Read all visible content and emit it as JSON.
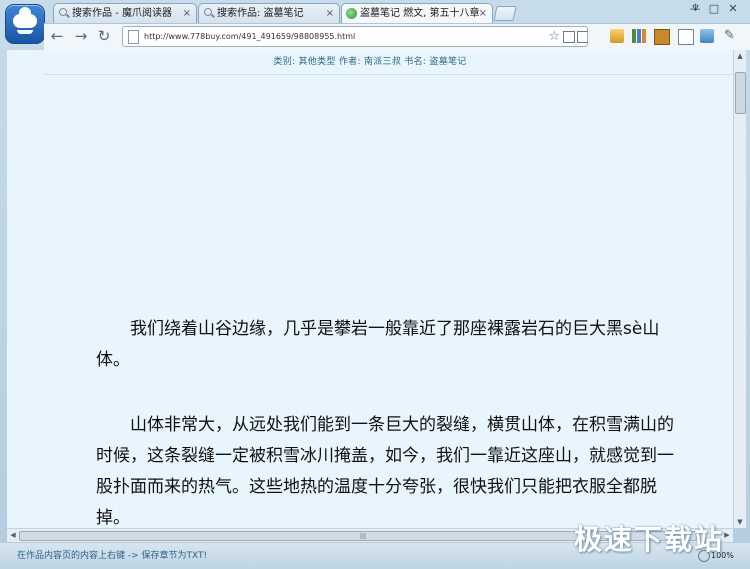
{
  "tabs": [
    {
      "label": "搜索作品 - 魔爪阅读器",
      "icon": "search-icon",
      "active": false
    },
    {
      "label": "搜索作品: 盗墓笔记",
      "icon": "search-icon",
      "active": false
    },
    {
      "label": "盗墓笔记 燃文, 第五十八章",
      "icon": "globe-icon",
      "active": true
    }
  ],
  "tab_close_glyph": "×",
  "toolbar": {
    "back": "←",
    "forward": "→",
    "reload": "↻",
    "url": "http://www.778buy.com/491_491659/98808955.html",
    "star": "☆"
  },
  "window": {
    "minimize": "—",
    "maximize": "□",
    "close": "✕"
  },
  "page": {
    "meta": "类别: 其他类型  作者: 南派三叔  书名: 盗墓笔记",
    "paragraphs": [
      "我们绕着山谷边缘，几乎是攀岩一般靠近了那座裸露岩石的巨大黑sè山体。",
      "山体非常大，从远处我们能到一条巨大的裂缝，横贯山体，在积雪满山的时候，这条裂缝一定被积雪冰川掩盖，如今，我们一靠近这座山，就感觉到一股扑面而来的热气。这些地热的温度十分夸张，很快我们只能把衣服全都脱掉。"
    ]
  },
  "status": {
    "text": "在作品内容页的内容上右键 -> 保存章节为TXT!",
    "zoom": "100%"
  },
  "watermark": "极速下载站",
  "colors": {
    "accent": "#2e6a87",
    "content_bg": "#e8f5fc",
    "frame": "#c7dcea"
  }
}
